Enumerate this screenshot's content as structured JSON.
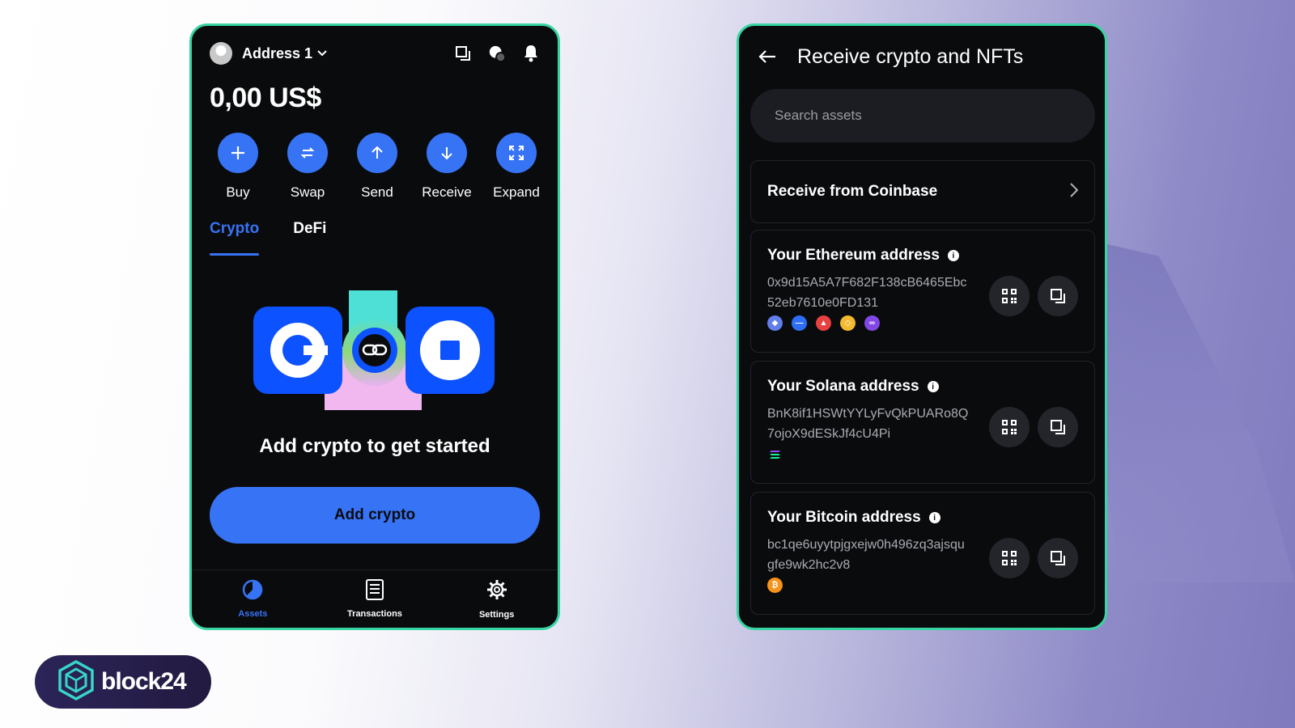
{
  "left_app": {
    "address_name": "Address 1",
    "balance": "0,00 US$",
    "actions": [
      {
        "label": "Buy",
        "icon": "plus-icon"
      },
      {
        "label": "Swap",
        "icon": "swap-icon"
      },
      {
        "label": "Send",
        "icon": "arrow-up-icon"
      },
      {
        "label": "Receive",
        "icon": "arrow-down-icon"
      },
      {
        "label": "Expand",
        "icon": "expand-icon"
      }
    ],
    "tabs": [
      {
        "label": "Crypto",
        "active": true
      },
      {
        "label": "DeFi",
        "active": false
      }
    ],
    "empty_title": "Add crypto to get started",
    "add_button": "Add crypto",
    "nav": [
      {
        "label": "Assets",
        "icon": "pie-chart-icon",
        "active": true
      },
      {
        "label": "Transactions",
        "icon": "document-icon",
        "active": false
      },
      {
        "label": "Settings",
        "icon": "gear-icon",
        "active": false
      }
    ]
  },
  "right_app": {
    "title": "Receive crypto and NFTs",
    "search_placeholder": "Search assets",
    "receive_from": "Receive from Coinbase",
    "addresses": [
      {
        "title": "Your Ethereum address",
        "address": "0x9d15A5A7F682F138cB6465Ebc52eb7610e0FD131",
        "chains": [
          {
            "name": "ethereum",
            "color": "#627eea"
          },
          {
            "name": "base",
            "color": "#2e6ef5"
          },
          {
            "name": "avalanche",
            "color": "#e84142"
          },
          {
            "name": "bnb",
            "color": "#f3ba2f"
          },
          {
            "name": "polygon",
            "color": "#8247e5"
          }
        ]
      },
      {
        "title": "Your Solana address",
        "address": "BnK8if1HSWtYYLyFvQkPUARo8Q7ojoX9dESkJf4cU4Pi",
        "chains": [
          {
            "name": "solana",
            "color": "#14f195"
          }
        ]
      },
      {
        "title": "Your Bitcoin address",
        "address": "bc1qe6uyytpjgxejw0h496zq3ajsqugfe9wk2hc2v8",
        "chains": [
          {
            "name": "bitcoin",
            "color": "#f7931a"
          }
        ]
      }
    ]
  },
  "brand": {
    "logo_text": "block24",
    "accent": "#3773f5",
    "frame": "#37d5a3"
  }
}
